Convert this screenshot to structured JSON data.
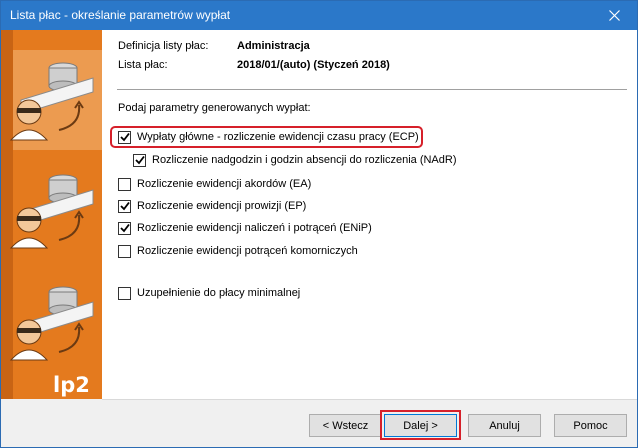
{
  "window": {
    "title": "Lista płac - określanie parametrów wypłat",
    "close_icon": "close-icon"
  },
  "sidebar": {
    "brand": "lp2",
    "accent": "#e47a1e"
  },
  "info": {
    "definition_label": "Definicja listy płac:",
    "definition_value": "Administracja",
    "list_label": "Lista płac:",
    "list_value": "2018/01/(auto) (Styczeń 2018)"
  },
  "prompt": "Podaj parametry generowanych wypłat:",
  "options": [
    {
      "label": "Wypłaty główne - rozliczenie ewidencji czasu pracy (ECP)",
      "checked": true
    },
    {
      "label": "Rozliczenie nadgodzin i godzin absencji do rozliczenia (NAdR)",
      "checked": true
    },
    {
      "label": "Rozliczenie ewidencji akordów (EA)",
      "checked": false
    },
    {
      "label": "Rozliczenie ewidencji prowizji (EP)",
      "checked": true
    },
    {
      "label": "Rozliczenie ewidencji naliczeń i potrąceń (ENiP)",
      "checked": true
    },
    {
      "label": "Rozliczenie ewidencji potrąceń komorniczych",
      "checked": false
    },
    {
      "label": "Uzupełnienie do płacy minimalnej",
      "checked": false
    }
  ],
  "buttons": {
    "back": "< Wstecz",
    "next": "Dalej >",
    "cancel": "Anuluj",
    "help": "Pomoc"
  },
  "highlight_color": "#d6202a"
}
